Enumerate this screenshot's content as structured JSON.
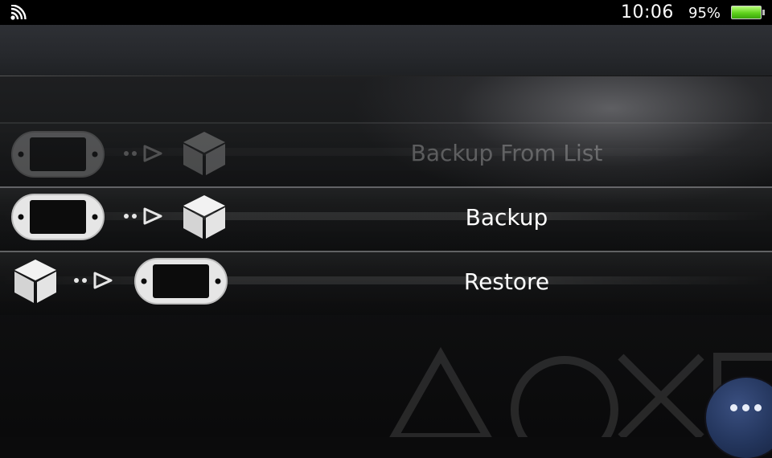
{
  "status_bar": {
    "time": "10:06",
    "battery_percent": "95%",
    "wifi_icon": "wifi-icon",
    "battery_icon": "battery-icon",
    "battery_color": "#5fd11c"
  },
  "menu": {
    "items": [
      {
        "label": "Backup From List",
        "enabled": false,
        "icons": [
          "vita-console-icon",
          "arrow-right-icon",
          "package-box-icon"
        ]
      },
      {
        "label": "Backup",
        "enabled": true,
        "icons": [
          "vita-console-icon",
          "arrow-right-icon",
          "package-box-icon"
        ]
      },
      {
        "label": "Restore",
        "enabled": true,
        "icons": [
          "package-box-icon",
          "arrow-right-icon",
          "vita-console-icon"
        ]
      }
    ]
  },
  "options_button": {
    "icon": "ellipsis-icon"
  },
  "background": {
    "watermark_icon": "playstation-symbols-icon"
  }
}
